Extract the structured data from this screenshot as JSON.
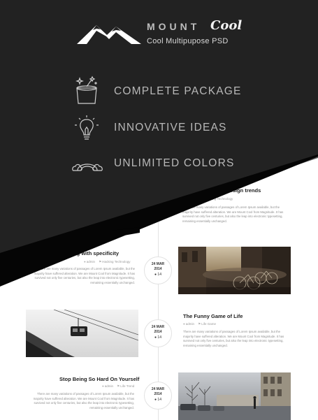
{
  "brand": {
    "name": "MOUNT",
    "name_script": "Cool",
    "tagline": "Cool Multipupose PSD"
  },
  "features": [
    {
      "icon": "magic-hat-icon",
      "label": "COMPLETE PACKAGE"
    },
    {
      "icon": "lightbulb-icon",
      "label": "INNOVATIVE IDEAS"
    },
    {
      "icon": "rainbow-cloud-icon",
      "label": "UNLIMITED COLORS"
    }
  ],
  "colors": {
    "dark_bg": "#222222",
    "band_gray": "#5a5a5a",
    "band_black": "#050505",
    "text_light": "#b8b8b8",
    "timeline_line": "#e3e3e3"
  },
  "timeline": {
    "posts": [
      {
        "title": "About the design trends",
        "meta_author": "admin",
        "meta_category": "Hacking Technology",
        "body": "There are many variations of passages of Lorem Ipsum available, but the majority have suffered alteration. We are Mount Cool from Magnitude. It has survived not only five centuries, but also the leap into electronic typesetting, remaining essentially unchanged."
      },
      {
        "title": "dealing with specificity",
        "meta_author": "admin",
        "meta_category": "Hacking Technology",
        "body": "There are many variations of passages of Lorem Ipsum available, but the majority have suffered alteration. We are Mount Cool from Magnitude. It has survived not only five centuries, but also the leap into electronic typesetting, remaining essentially unchanged.",
        "date_day": "24 MAR",
        "date_year": "2014",
        "comments": "14"
      },
      {
        "title": "The Funny Game of Life",
        "meta_author": "admin",
        "meta_category": "Life Game",
        "body": "There are many variations of passages of Lorem Ipsum available, but the majority have suffered alteration. We are Mount Cool from Magnitude. It has survived not only five centuries, but also the leap into electronic typesetting, remaining essentially unchanged.",
        "date_day": "24 MAR",
        "date_year": "2014",
        "comments": "14"
      },
      {
        "title": "Stop Being So Hard On Yourself",
        "meta_author": "admin",
        "meta_category": "Life Trend",
        "body": "There are many variations of passages of Lorem Ipsum available, but the majority have suffered alteration. We are Mount Cool from Magnitude. It has survived not only five centuries, but also the leap into electronic typesetting, remaining essentially unchanged.",
        "date_day": "24 MAR",
        "date_year": "2014",
        "comments": "14"
      }
    ]
  },
  "icons": {
    "author": "user-icon",
    "category": "tag-icon",
    "comments": "comment-icon",
    "logo": "mountain-logo-icon"
  }
}
